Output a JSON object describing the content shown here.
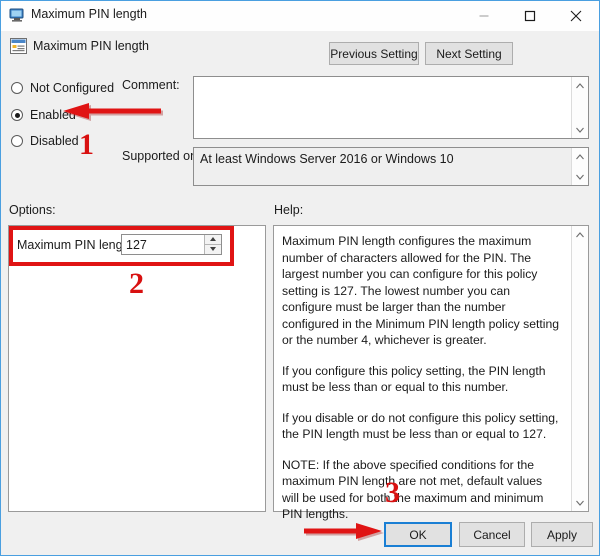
{
  "window": {
    "title": "Maximum PIN length",
    "title_icon": "computer-monitor-icon",
    "minimize_label": "Minimize",
    "maximize_label": "Maximize",
    "close_label": "Close"
  },
  "header": {
    "icon": "policy-setting-icon",
    "title": "Maximum PIN length",
    "previous_label": "Previous Setting",
    "next_label": "Next Setting"
  },
  "state": {
    "options": [
      {
        "label": "Not Configured",
        "selected": false
      },
      {
        "label": "Enabled",
        "selected": true
      },
      {
        "label": "Disabled",
        "selected": false
      }
    ]
  },
  "comment": {
    "label": "Comment:",
    "value": ""
  },
  "supported": {
    "label": "Supported on:",
    "value": "At least Windows Server 2016 or Windows 10"
  },
  "options_panel": {
    "label": "Options:",
    "field_label": "Maximum PIN length",
    "field_value": "127"
  },
  "help_panel": {
    "label": "Help:",
    "paragraphs": [
      "Maximum PIN length configures the maximum number of characters allowed for the PIN.  The largest number you can configure for this policy setting is 127. The lowest number you can configure must be larger than the number configured in the Minimum PIN length policy setting or the number 4, whichever is greater.",
      "If you configure this policy setting, the PIN length must be less than or equal to this number.",
      "If you disable or do not configure this policy setting, the PIN length must be less than or equal to 127.",
      "NOTE: If the above specified conditions for the maximum PIN length are not met, default values will be used for both the maximum and minimum PIN lengths."
    ]
  },
  "footer": {
    "ok_label": "OK",
    "cancel_label": "Cancel",
    "apply_label": "Apply"
  },
  "annotations": {
    "marker_1": "1",
    "marker_2": "2",
    "marker_3": "3",
    "color": "#d81010"
  }
}
